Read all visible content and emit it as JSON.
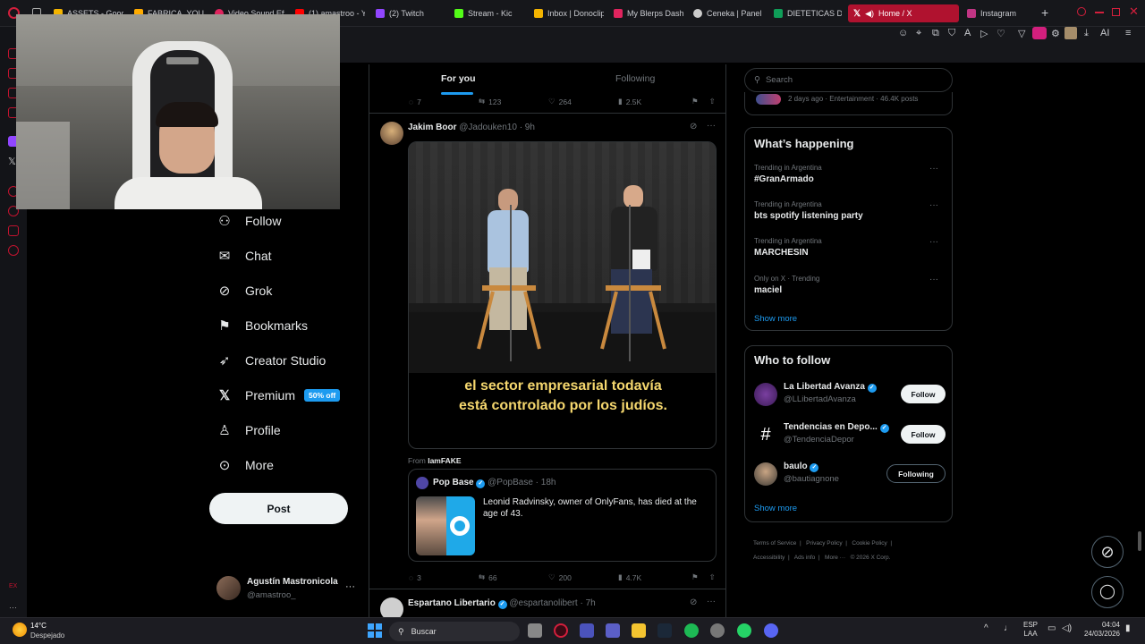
{
  "browser": {
    "tabs": [
      {
        "label": "ASSETS - Goog",
        "color": "#f4b400"
      },
      {
        "label": "FABRICA_YOUT",
        "color": "#ffab00"
      },
      {
        "label": "Video Sound Eff",
        "color": "#e0245e"
      },
      {
        "label": "(1) amastroo - Y",
        "color": "#ff0000"
      },
      {
        "label": "(2) Twitch",
        "color": "#9146ff"
      },
      {
        "label": "Stream - Kic",
        "color": "#53fc18"
      },
      {
        "label": "Inbox | Donoclip",
        "color": "#f4b400"
      },
      {
        "label": "My Blerps Dash",
        "color": "#e0245e"
      },
      {
        "label": "Ceneka | Panel",
        "color": "#cccccc"
      },
      {
        "label": "DIETETICAS DE",
        "color": "#0f9d58"
      },
      {
        "label": "Home / X",
        "color": "#ffffff"
      },
      {
        "label": "Instagram",
        "color": "#c13584"
      }
    ],
    "toolbar_ai": "AI",
    "accent": "#b0122f"
  },
  "nav": {
    "items": [
      {
        "label": "Follow",
        "icon": "follow-icon"
      },
      {
        "label": "Chat",
        "icon": "chat-icon"
      },
      {
        "label": "Grok",
        "icon": "grok-icon"
      },
      {
        "label": "Bookmarks",
        "icon": "bookmark-icon"
      },
      {
        "label": "Creator Studio",
        "icon": "rocket-icon"
      },
      {
        "label": "Premium",
        "icon": "x-logo-icon"
      },
      {
        "label": "Profile",
        "icon": "profile-icon"
      },
      {
        "label": "More",
        "icon": "more-icon"
      }
    ],
    "premium_badge": "50% off",
    "post_label": "Post",
    "account": {
      "name": "Agustín Mastronicola",
      "handle": "@amastroo_"
    }
  },
  "feed": {
    "tabs": {
      "for_you": "For you",
      "following": "Following"
    },
    "prev_actions": {
      "replies": "7",
      "reposts": "123",
      "likes": "264",
      "views": "2.5K"
    },
    "post": {
      "name": "Jakim Boor",
      "handle": "@Jadouken10",
      "time": "· 9h",
      "caption_line1": "el sector empresarial todavía",
      "caption_line2": "está controlado por los judíos.",
      "from_label": "From",
      "from_user": "IamFAKE",
      "quote": {
        "name": "Pop Base",
        "handle": "@PopBase",
        "time": "· 18h",
        "text": "Leonid Radvinsky, owner of OnlyFans, has died at the age of 43."
      },
      "actions": {
        "replies": "3",
        "reposts": "66",
        "likes": "200",
        "views": "4.7K"
      }
    },
    "next_post": {
      "name": "Espartano Libertario",
      "handle": "@espartanolibert",
      "time": "· 7h"
    }
  },
  "sidebar": {
    "search_placeholder": "Search",
    "topic_meta": "2 days ago · Entertainment · 46.4K posts",
    "happening_title": "What’s happening",
    "trends": [
      {
        "category": "Trending in Argentina",
        "name": "#GranArmado"
      },
      {
        "category": "Trending in Argentina",
        "name": "bts spotify listening party"
      },
      {
        "category": "Trending in Argentina",
        "name": "MARCHESIN"
      },
      {
        "category": "Only on X · Trending",
        "name": "maciel"
      }
    ],
    "show_more": "Show more",
    "who_title": "Who to follow",
    "who": [
      {
        "name": "La Libertad Avanza",
        "handle": "@LLibertadAvanza",
        "button": "Follow"
      },
      {
        "name": "Tendencias en Depo...",
        "handle": "@TendenciaDepor",
        "button": "Follow"
      },
      {
        "name": "baulo",
        "handle": "@bautiagnone",
        "button": "Following"
      }
    ],
    "footer": [
      "Terms of Service",
      "|",
      "Privacy Policy",
      "|",
      "Cookie Policy",
      "|",
      "Accessibility",
      "|",
      "Ads info",
      "|",
      "More ···",
      "© 2026 X Corp."
    ]
  },
  "taskbar": {
    "weather_temp": "14°C",
    "weather_desc": "Despejado",
    "search_placeholder": "Buscar",
    "lang": "ESP",
    "lang2": "LAA",
    "time": "04:04",
    "date": "24/03/2026"
  }
}
